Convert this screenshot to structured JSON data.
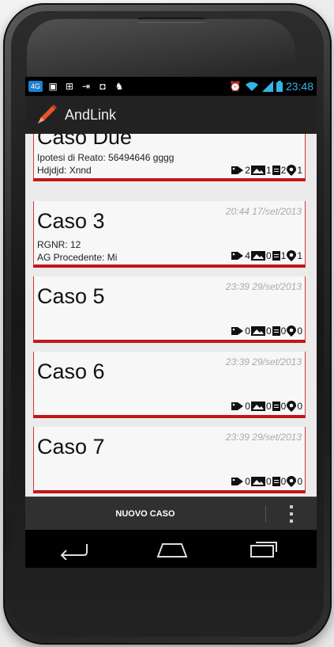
{
  "status_bar": {
    "left_icons": [
      "4g-badge-icon",
      "image-icon",
      "sync-icon",
      "exit-icon",
      "chat-icon",
      "android-icon"
    ],
    "network_label": "4G",
    "time": "23:48"
  },
  "action_bar": {
    "title": "AndLink",
    "accent": "#e8542b"
  },
  "cases": [
    {
      "title": "Caso Due",
      "date": "",
      "line1": "Ipotesi di Reato: 56494646 gggg",
      "line2": "Hdjdjd: Xnnd",
      "counts": {
        "tags": "2",
        "images": "1",
        "docs": "2",
        "places": "1"
      }
    },
    {
      "title": "Caso 3",
      "date": "20:44 17/set/2013",
      "line1": "RGNR: 12",
      "line2": "AG Procedente: Mi",
      "counts": {
        "tags": "4",
        "images": "0",
        "docs": "1",
        "places": "1"
      }
    },
    {
      "title": "Caso 5",
      "date": "23:39 29/set/2013",
      "line1": "",
      "line2": "",
      "counts": {
        "tags": "0",
        "images": "0",
        "docs": "0",
        "places": "0"
      }
    },
    {
      "title": "Caso 6",
      "date": "23:39 29/set/2013",
      "line1": "",
      "line2": "",
      "counts": {
        "tags": "0",
        "images": "0",
        "docs": "0",
        "places": "0"
      }
    },
    {
      "title": "Caso 7",
      "date": "23:39 29/set/2013",
      "line1": "",
      "line2": "",
      "counts": {
        "tags": "0",
        "images": "0",
        "docs": "0",
        "places": "0"
      }
    }
  ],
  "bottom_bar": {
    "new_case_label": "NUOVO CASO"
  },
  "nav_bar": {
    "buttons": [
      "back-icon",
      "home-icon",
      "recent-apps-icon"
    ]
  },
  "colors": {
    "card_border": "#c01818",
    "status_accent": "#33b5e5"
  }
}
